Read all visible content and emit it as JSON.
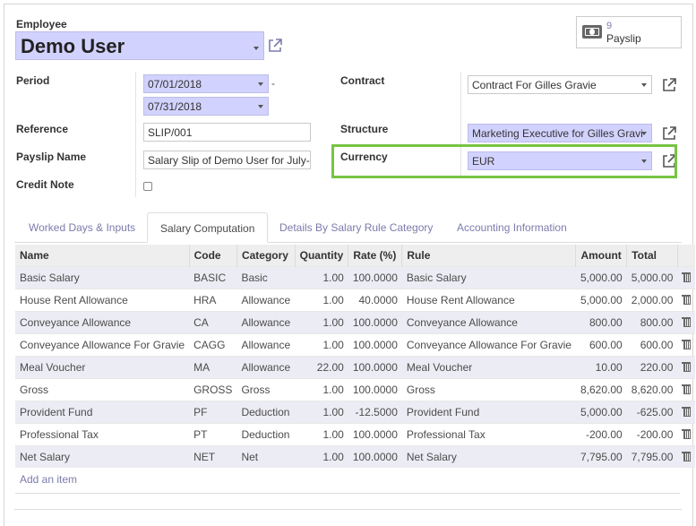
{
  "employee": {
    "label": "Employee",
    "value": "Demo User"
  },
  "smart_button": {
    "count": "9",
    "label": "Payslip"
  },
  "period": {
    "label": "Period",
    "date_from": "07/01/2018",
    "separator": "-",
    "date_to": "07/31/2018"
  },
  "reference": {
    "label": "Reference",
    "value": "SLIP/001"
  },
  "payslip_name": {
    "label": "Payslip Name",
    "value": "Salary Slip of Demo User for July-"
  },
  "credit_note": {
    "label": "Credit Note",
    "checked": false
  },
  "contract": {
    "label": "Contract",
    "value": "Contract For Gilles Gravie"
  },
  "structure": {
    "label": "Structure",
    "value": "Marketing Executive for Gilles Gravi"
  },
  "currency": {
    "label": "Currency",
    "value": "EUR"
  },
  "highlight_color": "#77c443",
  "tabs": [
    {
      "label": "Worked Days & Inputs"
    },
    {
      "label": "Salary Computation"
    },
    {
      "label": "Details By Salary Rule Category"
    },
    {
      "label": "Accounting Information"
    }
  ],
  "table": {
    "headers": [
      "Name",
      "Code",
      "Category",
      "Quantity",
      "Rate (%)",
      "Rule",
      "Amount",
      "Total"
    ],
    "rows": [
      [
        "Basic Salary",
        "BASIC",
        "Basic",
        "1.00",
        "100.0000",
        "Basic Salary",
        "5,000.00",
        "5,000.00"
      ],
      [
        "House Rent Allowance",
        "HRA",
        "Allowance",
        "1.00",
        "40.0000",
        "House Rent Allowance",
        "5,000.00",
        "2,000.00"
      ],
      [
        "Conveyance Allowance",
        "CA",
        "Allowance",
        "1.00",
        "100.0000",
        "Conveyance Allowance",
        "800.00",
        "800.00"
      ],
      [
        "Conveyance Allowance For Gravie",
        "CAGG",
        "Allowance",
        "1.00",
        "100.0000",
        "Conveyance Allowance For Gravie",
        "600.00",
        "600.00"
      ],
      [
        "Meal Voucher",
        "MA",
        "Allowance",
        "22.00",
        "100.0000",
        "Meal Voucher",
        "10.00",
        "220.00"
      ],
      [
        "Gross",
        "GROSS",
        "Gross",
        "1.00",
        "100.0000",
        "Gross",
        "8,620.00",
        "8,620.00"
      ],
      [
        "Provident Fund",
        "PF",
        "Deduction",
        "1.00",
        "-12.5000",
        "Provident Fund",
        "5,000.00",
        "-625.00"
      ],
      [
        "Professional Tax",
        "PT",
        "Deduction",
        "1.00",
        "100.0000",
        "Professional Tax",
        "-200.00",
        "-200.00"
      ],
      [
        "Net Salary",
        "NET",
        "Net",
        "1.00",
        "100.0000",
        "Net Salary",
        "7,795.00",
        "7,795.00"
      ]
    ],
    "add_item": "Add an item"
  }
}
